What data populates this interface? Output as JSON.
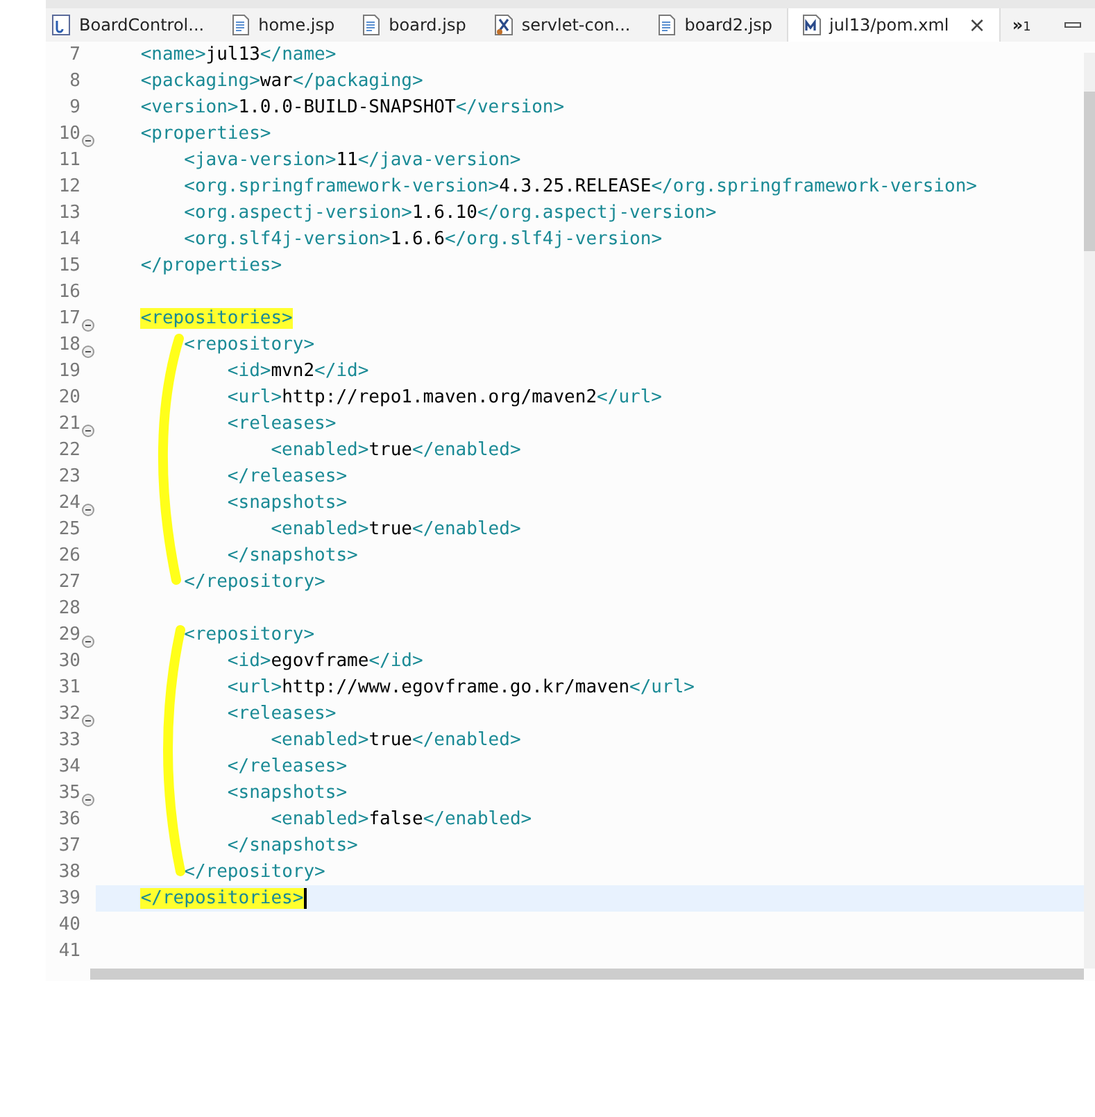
{
  "tabs": [
    {
      "label": "BoardControl...",
      "kind": "java",
      "selected": false
    },
    {
      "label": "home.jsp",
      "kind": "page",
      "selected": false
    },
    {
      "label": "board.jsp",
      "kind": "page",
      "selected": false
    },
    {
      "label": "servlet-con...",
      "kind": "config",
      "selected": false
    },
    {
      "label": "board2.jsp",
      "kind": "page",
      "selected": false
    },
    {
      "label": "jul13/pom.xml",
      "kind": "maven",
      "selected": true,
      "close": "×"
    }
  ],
  "overflow": {
    "glyph": "»",
    "count": "1"
  },
  "lines": [
    {
      "number": "7",
      "code": "    <name>jul13</name>",
      "foldable": false,
      "current": false,
      "highlighted": false
    },
    {
      "number": "8",
      "code": "    <packaging>war</packaging>",
      "foldable": false,
      "current": false,
      "highlighted": false
    },
    {
      "number": "9",
      "code": "    <version>1.0.0-BUILD-SNAPSHOT</version>",
      "foldable": false,
      "current": false,
      "highlighted": false
    },
    {
      "number": "10",
      "code": "    <properties>",
      "foldable": true,
      "current": false,
      "highlighted": false
    },
    {
      "number": "11",
      "code": "        <java-version>11</java-version>",
      "foldable": false,
      "current": false,
      "highlighted": false
    },
    {
      "number": "12",
      "code": "        <org.springframework-version>4.3.25.RELEASE</org.springframework-version>",
      "foldable": false,
      "current": false,
      "highlighted": false
    },
    {
      "number": "13",
      "code": "        <org.aspectj-version>1.6.10</org.aspectj-version>",
      "foldable": false,
      "current": false,
      "highlighted": false
    },
    {
      "number": "14",
      "code": "        <org.slf4j-version>1.6.6</org.slf4j-version>",
      "foldable": false,
      "current": false,
      "highlighted": false
    },
    {
      "number": "15",
      "code": "    </properties>",
      "foldable": false,
      "current": false,
      "highlighted": false
    },
    {
      "number": "16",
      "foldable": false,
      "current": false
    },
    {
      "number": "17",
      "code": "    <repositories>",
      "foldable": true,
      "current": false,
      "highlighted": true
    },
    {
      "number": "18",
      "code": "        <repository>",
      "foldable": true,
      "current": false,
      "highlighted": false
    },
    {
      "number": "19",
      "code": "            <id>mvn2</id>",
      "foldable": false,
      "current": false,
      "highlighted": false
    },
    {
      "number": "20",
      "code": "            <url>http://repo1.maven.org/maven2</url>",
      "foldable": false,
      "current": false,
      "highlighted": false
    },
    {
      "number": "21",
      "code": "            <releases>",
      "foldable": true,
      "current": false,
      "highlighted": false
    },
    {
      "number": "22",
      "code": "                <enabled>true</enabled>",
      "foldable": false,
      "current": false,
      "highlighted": false
    },
    {
      "number": "23",
      "code": "            </releases>",
      "foldable": false,
      "current": false,
      "highlighted": false
    },
    {
      "number": "24",
      "code": "            <snapshots>",
      "foldable": true,
      "current": false,
      "highlighted": false
    },
    {
      "number": "25",
      "code": "                <enabled>true</enabled>",
      "foldable": false,
      "current": false,
      "highlighted": false
    },
    {
      "number": "26",
      "code": "            </snapshots>",
      "foldable": false,
      "current": false,
      "highlighted": false
    },
    {
      "number": "27",
      "code": "        </repository>",
      "foldable": false,
      "current": false,
      "highlighted": false
    },
    {
      "number": "28",
      "foldable": false,
      "current": false
    },
    {
      "number": "29",
      "code": "        <repository>",
      "foldable": true,
      "current": false,
      "highlighted": false
    },
    {
      "number": "30",
      "code": "            <id>egovframe</id>",
      "foldable": false,
      "current": false,
      "highlighted": false
    },
    {
      "number": "31",
      "code": "            <url>http://www.egovframe.go.kr/maven</url>",
      "foldable": false,
      "current": false,
      "highlighted": false
    },
    {
      "number": "32",
      "code": "            <releases>",
      "foldable": true,
      "current": false,
      "highlighted": false
    },
    {
      "number": "33",
      "code": "                <enabled>true</enabled>",
      "foldable": false,
      "current": false,
      "highlighted": false
    },
    {
      "number": "34",
      "code": "            </releases>",
      "foldable": false,
      "current": false,
      "highlighted": false
    },
    {
      "number": "35",
      "code": "            <snapshots>",
      "foldable": true,
      "current": false,
      "highlighted": false
    },
    {
      "number": "36",
      "code": "                <enabled>false</enabled>",
      "foldable": false,
      "current": false,
      "highlighted": false
    },
    {
      "number": "37",
      "code": "            </snapshots>",
      "foldable": false,
      "current": false,
      "highlighted": false
    },
    {
      "number": "38",
      "code": "        </repository>",
      "foldable": false,
      "current": false,
      "highlighted": false
    },
    {
      "number": "39",
      "code": "    </repositories>",
      "foldable": false,
      "current": true,
      "highlighted": true
    },
    {
      "number": "40",
      "foldable": false,
      "current": false
    },
    {
      "number": "41",
      "foldable": false,
      "current": false
    }
  ]
}
